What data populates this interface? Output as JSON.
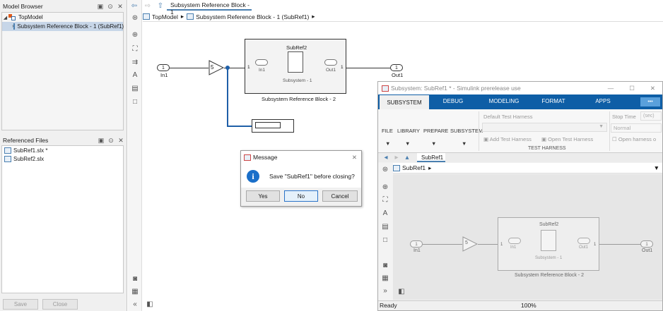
{
  "model_browser": {
    "title": "Model Browser",
    "tree": [
      {
        "label": "TopModel"
      },
      {
        "label": "Subsystem Reference Block - 1 (SubRef1)"
      }
    ]
  },
  "referenced_files": {
    "title": "Referenced Files",
    "files": [
      "SubRef1.slx *",
      "SubRef2.slx"
    ]
  },
  "footer": {
    "save": "Save",
    "close": "Close"
  },
  "main": {
    "tab_title": "Subsystem Reference Block - 1",
    "breadcrumb": [
      "TopModel",
      "Subsystem Reference Block - 1 (SubRef1)"
    ],
    "diagram": {
      "in_port": {
        "num": "1",
        "name": "In1"
      },
      "gain": "5",
      "ref_block": {
        "title": "SubRef2",
        "inner_label": "Subsystem - 1",
        "in_label": "In1",
        "out_label": "Out1",
        "port_in": "1",
        "port_out": "1",
        "name": "Subsystem Reference Block - 2"
      },
      "out_port": {
        "num": "1",
        "name": "Out1"
      }
    }
  },
  "dialog": {
    "title": "Message",
    "message": "Save \"SubRef1\" before closing?",
    "yes": "Yes",
    "no": "No",
    "cancel": "Cancel"
  },
  "window2": {
    "title": "Subsystem: SubRef1 * - Simulink prerelease use",
    "tabs": [
      "SUBSYSTEM",
      "DEBUG",
      "MODELING",
      "FORMAT",
      "APPS"
    ],
    "more": "•••",
    "ribbon": {
      "file": "FILE",
      "library": "LIBRARY",
      "prepare": "PREPARE",
      "subsystem": "SUBSYSTEM",
      "default_harness": "Default Test Harness",
      "add_harness": "Add Test Harness",
      "open_harness": "Open Test Harness",
      "test_harness": "TEST HARNESS",
      "stop_time": "Stop Time",
      "stop_value": "(sec)",
      "normal": "Normal",
      "open_harness_cb": "Open harness o"
    },
    "doc_tab": "SubRef1",
    "breadcrumb": "SubRef1",
    "diagram": {
      "in_port": {
        "num": "1",
        "name": "In1"
      },
      "gain": "5",
      "ref_block": {
        "title": "SubRef2",
        "inner_label": "Subsystem - 1",
        "in_label": "In1",
        "out_label": "Out1",
        "port_in": "1",
        "port_out": "1",
        "name": "Subsystem Reference Block - 2"
      },
      "out_port": {
        "num": "1",
        "name": "Out1"
      }
    },
    "status": {
      "ready": "Ready",
      "zoom": "100%"
    }
  }
}
